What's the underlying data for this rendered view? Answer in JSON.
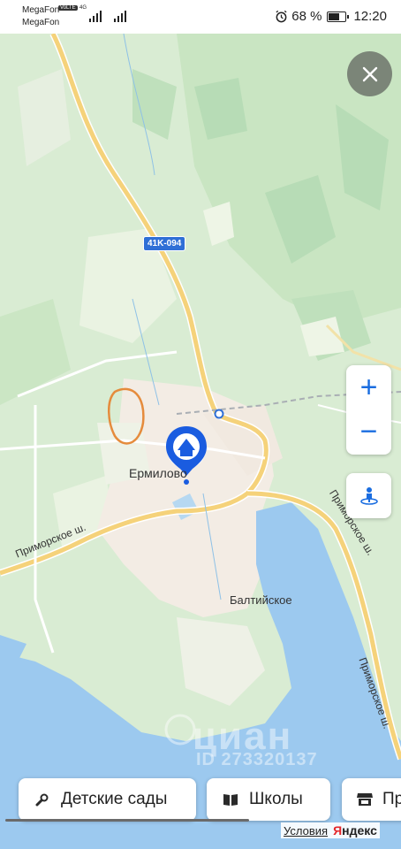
{
  "status_bar": {
    "carrier_primary": "MegaFon",
    "carrier_secondary": "MegaFon",
    "volte": "VoLTE",
    "network": "4G",
    "battery": "68 %",
    "time": "12:20"
  },
  "map": {
    "close_icon": "close-icon",
    "zoom_in": "+",
    "zoom_out": "−",
    "route_badge": "41K-094",
    "places": {
      "village_main": "Ермилово",
      "village_south": "Балтийское"
    },
    "roads": {
      "left": "Приморское ш.",
      "right_upper": "Приморское ш.",
      "right_lower": "Приморское ш."
    },
    "watermark_text": "циан",
    "watermark_id": "ID 273320137",
    "colors": {
      "land": "#d9ecd3",
      "forest": "#c5e3bf",
      "settlement": "#f3ece4",
      "water": "#9cc9ef",
      "road_major": "#f5d27a",
      "pin": "#1a5ce0",
      "accent": "#1a6de0"
    }
  },
  "chips": [
    {
      "label": "Детские сады",
      "icon": "pacifier-icon"
    },
    {
      "label": "Школы",
      "icon": "book-icon"
    },
    {
      "label": "Пр",
      "icon": "store-icon"
    }
  ],
  "attribution": {
    "terms": "Условия",
    "brand_y": "Я",
    "brand_rest": "ндекс"
  }
}
